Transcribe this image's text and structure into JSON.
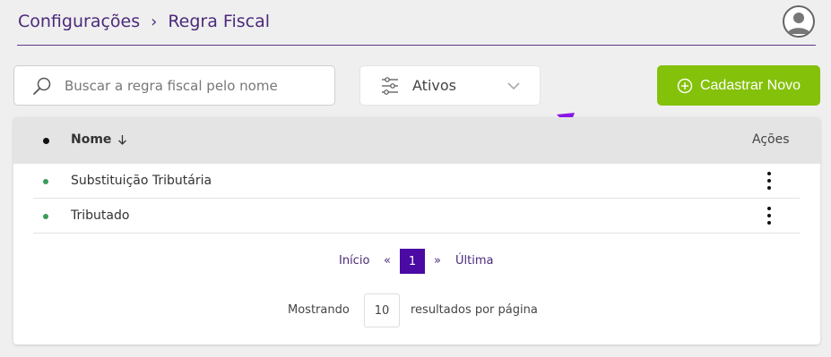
{
  "breadcrumb": {
    "parent": "Configurações",
    "separator": "›",
    "current": "Regra Fiscal"
  },
  "search": {
    "placeholder": "Buscar a regra fiscal pelo nome",
    "value": ""
  },
  "filter": {
    "selected": "Ativos"
  },
  "actions": {
    "new_label": "Cadastrar Novo"
  },
  "colors": {
    "accent": "#4a0aa3",
    "brand_green": "#84c10a",
    "status_active": "#3a9b5c",
    "annotation_arrow": "#8b16e8"
  },
  "table": {
    "columns": {
      "name": "Nome",
      "actions": "Ações"
    },
    "rows": [
      {
        "name": "Substituição Tributária"
      },
      {
        "name": "Tributado"
      }
    ]
  },
  "pagination": {
    "first": "Início",
    "prev": "«",
    "current": "1",
    "next": "»",
    "last": "Última"
  },
  "per_page": {
    "prefix": "Mostrando",
    "value": "10",
    "suffix": "resultados por página"
  }
}
